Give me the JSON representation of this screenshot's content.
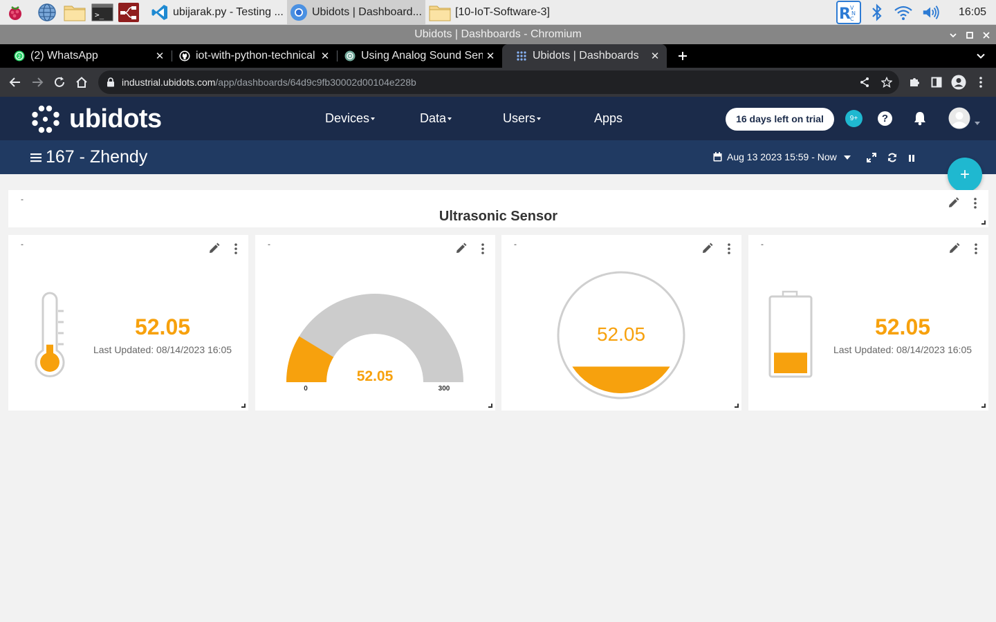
{
  "taskbar": {
    "tasks": [
      {
        "label": "ubijarak.py - Testing ..."
      },
      {
        "label": "Ubidots | Dashboard..."
      },
      {
        "label": "[10-IoT-Software-3]"
      }
    ],
    "clock": "16:05"
  },
  "window": {
    "title": "Ubidots | Dashboards - Chromium"
  },
  "tabs": [
    {
      "title": "(2) WhatsApp"
    },
    {
      "title": "iot-with-python-technical"
    },
    {
      "title": "Using Analog Sound Sensor"
    },
    {
      "title": "Ubidots | Dashboards"
    }
  ],
  "address": {
    "host": "industrial.ubidots.com",
    "path": "/app/dashboards/64d9c9fb30002d00104e228b"
  },
  "header": {
    "logo": "ubidots",
    "nav": [
      "Devices",
      "Data",
      "Users",
      "Apps"
    ],
    "trial": "16 days left on trial",
    "notif_count": "9+"
  },
  "dashboard": {
    "name": "167 - Zhendy",
    "date_range": "Aug 13 2023 15:59 - Now",
    "fab": "+"
  },
  "widgets": {
    "title_widget": {
      "dash": "-",
      "title": "Ultrasonic Sensor"
    },
    "thermometer": {
      "dash": "-",
      "value": "52.05",
      "updated": "Last Updated: 08/14/2023 16:05",
      "fill": 0.17
    },
    "gauge": {
      "dash": "-",
      "value": "52.05",
      "min": "0",
      "max": "300",
      "fraction": 0.1735
    },
    "tank": {
      "dash": "-",
      "value": "52.05",
      "fill": 0.17
    },
    "battery": {
      "dash": "-",
      "value": "52.05",
      "updated": "Last Updated: 08/14/2023 16:05",
      "fill": 0.17
    }
  },
  "colors": {
    "accent": "#f7a10d",
    "navy": "#1b2b4a",
    "teal": "#1fb8d0"
  }
}
